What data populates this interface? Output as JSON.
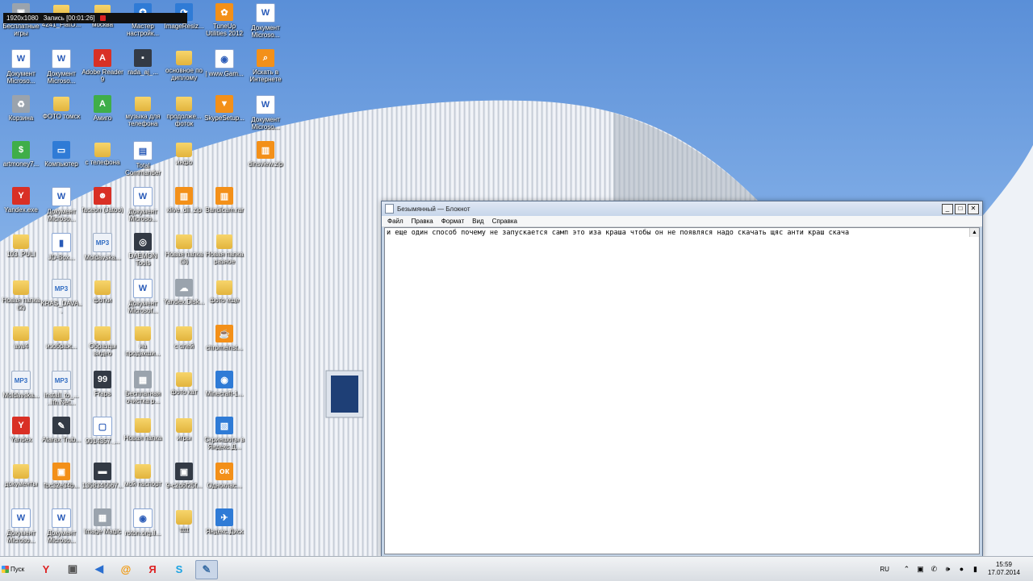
{
  "recorder": {
    "resolution": "1920x1080",
    "status": "Запись [00:01:26]"
  },
  "desktop_icons": [
    {
      "label": "Бесплатные игры",
      "type": "gray",
      "glyph": "▣"
    },
    {
      "label": "4241_FlatO...",
      "type": "folder",
      "glyph": ""
    },
    {
      "label": "москва",
      "type": "folder",
      "glyph": ""
    },
    {
      "label": "Мастер настройк...",
      "type": "blue",
      "glyph": "✪"
    },
    {
      "label": "ImageResiz...",
      "type": "blue",
      "glyph": "⟳"
    },
    {
      "label": "TuneUp Utilities 2012",
      "type": "orange",
      "glyph": "✿"
    },
    {
      "label": "Документ Microso...",
      "type": "doc",
      "glyph": "W"
    },
    {
      "label": "Документ Microso...",
      "type": "doc",
      "glyph": "W"
    },
    {
      "label": "Документ Microso...",
      "type": "doc",
      "glyph": "W"
    },
    {
      "label": "Adobe Reader 9",
      "type": "red",
      "glyph": "A"
    },
    {
      "label": "rada_aj_...",
      "type": "dark",
      "glyph": "▪"
    },
    {
      "label": "основное по диплому",
      "type": "folder",
      "glyph": ""
    },
    {
      "label": "| www.Gam...",
      "type": "doc",
      "glyph": "◉"
    },
    {
      "label": "Искать в Интернете",
      "type": "orange",
      "glyph": "⌕"
    },
    {
      "label": "Корзина",
      "type": "gray",
      "glyph": "♻"
    },
    {
      "label": "ФОТО томск",
      "type": "folder",
      "glyph": ""
    },
    {
      "label": "Амиго",
      "type": "green",
      "glyph": "A"
    },
    {
      "label": "музыка для телефона",
      "type": "folder",
      "glyph": ""
    },
    {
      "label": "продолже... фоток",
      "type": "folder",
      "glyph": ""
    },
    {
      "label": "SkypeSetup...",
      "type": "orange",
      "glyph": "▼"
    },
    {
      "label": "Документ Microso...",
      "type": "doc",
      "glyph": "W"
    },
    {
      "label": "artmoney7...",
      "type": "green",
      "glyph": "$"
    },
    {
      "label": "Компьютер",
      "type": "blue",
      "glyph": "▭"
    },
    {
      "label": "с телефона",
      "type": "folder",
      "glyph": ""
    },
    {
      "label": "Total Commander",
      "type": "doc",
      "glyph": "▤"
    },
    {
      "label": "инфо",
      "type": "folder",
      "glyph": ""
    },
    {
      "label": "",
      "type": "none",
      "glyph": ""
    },
    {
      "label": "dinsview.zip",
      "type": "orange",
      "glyph": "▥"
    },
    {
      "label": "Yandex.exe",
      "type": "red",
      "glyph": "Y"
    },
    {
      "label": "Документ Microso...",
      "type": "doc",
      "glyph": "W"
    },
    {
      "label": "faceon (Jatoo)",
      "type": "red",
      "glyph": "☻"
    },
    {
      "label": "Документ Microso...",
      "type": "doc",
      "glyph": "W"
    },
    {
      "label": "xlive_dll_zip",
      "type": "orange",
      "glyph": "▥"
    },
    {
      "label": "Bandicam.rar",
      "type": "orange",
      "glyph": "▥"
    },
    {
      "label": "",
      "type": "none",
      "glyph": ""
    },
    {
      "label": "103_PULI",
      "type": "folder",
      "glyph": ""
    },
    {
      "label": "JD-Box...",
      "type": "doc",
      "glyph": "▮"
    },
    {
      "label": "Moldavska...",
      "type": "mp3",
      "glyph": "MP3"
    },
    {
      "label": "DAEMON Tools",
      "type": "dark",
      "glyph": "◎"
    },
    {
      "label": "Новая папка (3)",
      "type": "folder",
      "glyph": ""
    },
    {
      "label": "Новая папка разное",
      "type": "folder",
      "glyph": ""
    },
    {
      "label": "",
      "type": "none",
      "glyph": ""
    },
    {
      "label": "Новая папка (2)",
      "type": "folder",
      "glyph": ""
    },
    {
      "label": "KRAS_DAVA...",
      "type": "mp3",
      "glyph": "MP3"
    },
    {
      "label": "фотки",
      "type": "folder",
      "glyph": ""
    },
    {
      "label": "Документ Microsof...",
      "type": "doc",
      "glyph": "W"
    },
    {
      "label": "Yandex.Disk...",
      "type": "gray",
      "glyph": "☁"
    },
    {
      "label": "фото еще",
      "type": "folder",
      "glyph": ""
    },
    {
      "label": "",
      "type": "none",
      "glyph": ""
    },
    {
      "label": "ava4",
      "type": "folder",
      "glyph": ""
    },
    {
      "label": "изображ...",
      "type": "folder",
      "glyph": ""
    },
    {
      "label": "Образцы видео",
      "type": "folder",
      "glyph": ""
    },
    {
      "label": "на продакши...",
      "type": "folder",
      "glyph": ""
    },
    {
      "label": "с олей",
      "type": "folder",
      "glyph": ""
    },
    {
      "label": "chromeinst...",
      "type": "orange",
      "glyph": "☕"
    },
    {
      "label": "",
      "type": "none",
      "glyph": ""
    },
    {
      "label": "Moldavska...",
      "type": "mp3",
      "glyph": "MP3"
    },
    {
      "label": "install_to_... ..Ifn.Net...",
      "type": "mp3",
      "glyph": "MP3"
    },
    {
      "label": "Fraps",
      "type": "dark",
      "glyph": "99"
    },
    {
      "label": "Бесплатная очистка р...",
      "type": "gray",
      "glyph": "▦"
    },
    {
      "label": "фото кат",
      "type": "folder",
      "glyph": ""
    },
    {
      "label": "Minecraft-1...",
      "type": "blue",
      "glyph": "◉"
    },
    {
      "label": "",
      "type": "none",
      "glyph": ""
    },
    {
      "label": "Yandex",
      "type": "red",
      "glyph": "Y"
    },
    {
      "label": "Atarax Trub...",
      "type": "dark",
      "glyph": "✎"
    },
    {
      "label": "9014357_...",
      "type": "doc",
      "glyph": "▢"
    },
    {
      "label": "Новая папка",
      "type": "folder",
      "glyph": ""
    },
    {
      "label": "игры",
      "type": "folder",
      "glyph": ""
    },
    {
      "label": "Скриншоты в Яндекс.Д...",
      "type": "blue",
      "glyph": "▧"
    },
    {
      "label": "",
      "type": "none",
      "glyph": ""
    },
    {
      "label": "документы",
      "type": "folder",
      "glyph": ""
    },
    {
      "label": "fbc32e34b...",
      "type": "orange",
      "glyph": "▣"
    },
    {
      "label": "1358345567...",
      "type": "dark",
      "glyph": "▬"
    },
    {
      "label": "мой паспорт",
      "type": "folder",
      "glyph": ""
    },
    {
      "label": "9-c2d6f25f...",
      "type": "dark",
      "glyph": "▣"
    },
    {
      "label": "Одноклас...",
      "type": "orange",
      "glyph": "ок"
    },
    {
      "label": "",
      "type": "none",
      "glyph": ""
    },
    {
      "label": "Документ Microso...",
      "type": "doc",
      "glyph": "W"
    },
    {
      "label": "Документ Microso...",
      "type": "doc",
      "glyph": "W"
    },
    {
      "label": "Image Magic",
      "type": "gray",
      "glyph": "▦"
    },
    {
      "label": "roton.org.il...",
      "type": "doc",
      "glyph": "◉"
    },
    {
      "label": "ttttt",
      "type": "folder",
      "glyph": ""
    },
    {
      "label": "Яндекс.Диск",
      "type": "blue",
      "glyph": "✈"
    },
    {
      "label": "",
      "type": "none",
      "glyph": ""
    }
  ],
  "notepad": {
    "title": "Безымянный — Блокнот",
    "menu": [
      "Файл",
      "Правка",
      "Формат",
      "Вид",
      "Справка"
    ],
    "content": "и еще один способ почему не запускается самп это иза краша чтобы он не появляся надо скачать щяс анти краш скача",
    "buttons": {
      "minimize": "_",
      "maximize": "□",
      "close": "✕"
    }
  },
  "taskbar": {
    "start_label": "Пуск",
    "apps": [
      {
        "name": "yandex",
        "glyph": "Y",
        "color": "#d22"
      },
      {
        "name": "floppy",
        "glyph": "▣",
        "color": "#555"
      },
      {
        "name": "audio",
        "glyph": "◀",
        "color": "#2a6fd0"
      },
      {
        "name": "mail",
        "glyph": "@",
        "color": "#f29400"
      },
      {
        "name": "yandex-browser",
        "glyph": "Я",
        "color": "#d22"
      },
      {
        "name": "skype",
        "glyph": "S",
        "color": "#1aa3e3"
      },
      {
        "name": "notepad",
        "glyph": "✎",
        "color": "#3a6ea5"
      }
    ],
    "language": "RU",
    "time": "15:59",
    "date": "17.07.2014"
  },
  "colors": {
    "accent": "#3a6ea5",
    "titlebar": "#c7d6ea"
  }
}
